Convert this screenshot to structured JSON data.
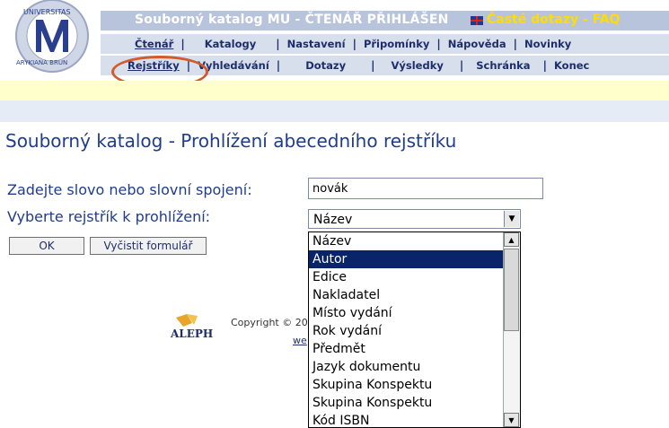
{
  "header": {
    "title": "Souborný katalog MU - ČTENÁŘ PŘIHLÁŠEN",
    "faq_label": "Časté dotazy - FAQ",
    "nav_row1": [
      "Čtenář",
      "Katalogy",
      "Nastavení",
      "Připomínky",
      "Nápověda",
      "Novinky"
    ],
    "nav_row2": [
      "Rejstříky",
      "Vyhledávání",
      "Dotazy",
      "Výsledky",
      "Schránka",
      "Konec"
    ]
  },
  "main": {
    "page_title": "Souborný katalog - Prohlížení abecedního rejstříku",
    "label_search": "Zadejte slovo nebo slovní spojení:",
    "label_index": "Vyberte rejstřík k prohlížení:",
    "search_value": "novák",
    "selected_index": "Název",
    "ok_label": "OK",
    "clear_label": "Vyčistit formulář"
  },
  "dropdown": {
    "options": [
      "Název",
      "Autor",
      "Edice",
      "Nakladatel",
      "Místo vydání",
      "Rok vydání",
      "Předmět",
      "Jazyk dokumentu",
      "Skupina Konspektu",
      "Skupina Konspektu",
      "Kód ISBN"
    ],
    "highlighted_index": 1
  },
  "footer": {
    "copyright": "Copyright © 20",
    "link_text": "we"
  },
  "colors": {
    "accent": "#1f3d8a",
    "title_bar": "#b8c4dc",
    "faq": "#ffdd00",
    "highlight": "#0a246a",
    "oval": "#d35a2a"
  }
}
